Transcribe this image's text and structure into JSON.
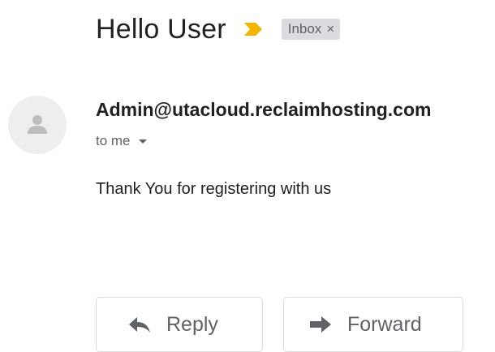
{
  "email": {
    "subject": "Hello User",
    "label_chip": "Inbox",
    "label_chip_close": "×",
    "sender": "Admin@utacloud.reclaimhosting.com",
    "recipient_text": "to me",
    "body": "Thank You for registering with us"
  },
  "actions": {
    "reply_label": "Reply",
    "forward_label": "Forward"
  },
  "icons": {
    "importance": "importance-marker-icon",
    "avatar": "person-icon",
    "recipient_toggle": "caret-down-icon",
    "reply": "reply-arrow-icon",
    "forward": "forward-arrow-icon"
  },
  "colors": {
    "importance_marker": "#f4b400",
    "chip_background": "#dadce0",
    "avatar_background": "#eeeeee",
    "muted_text": "#5f6368",
    "primary_text": "#202124"
  }
}
